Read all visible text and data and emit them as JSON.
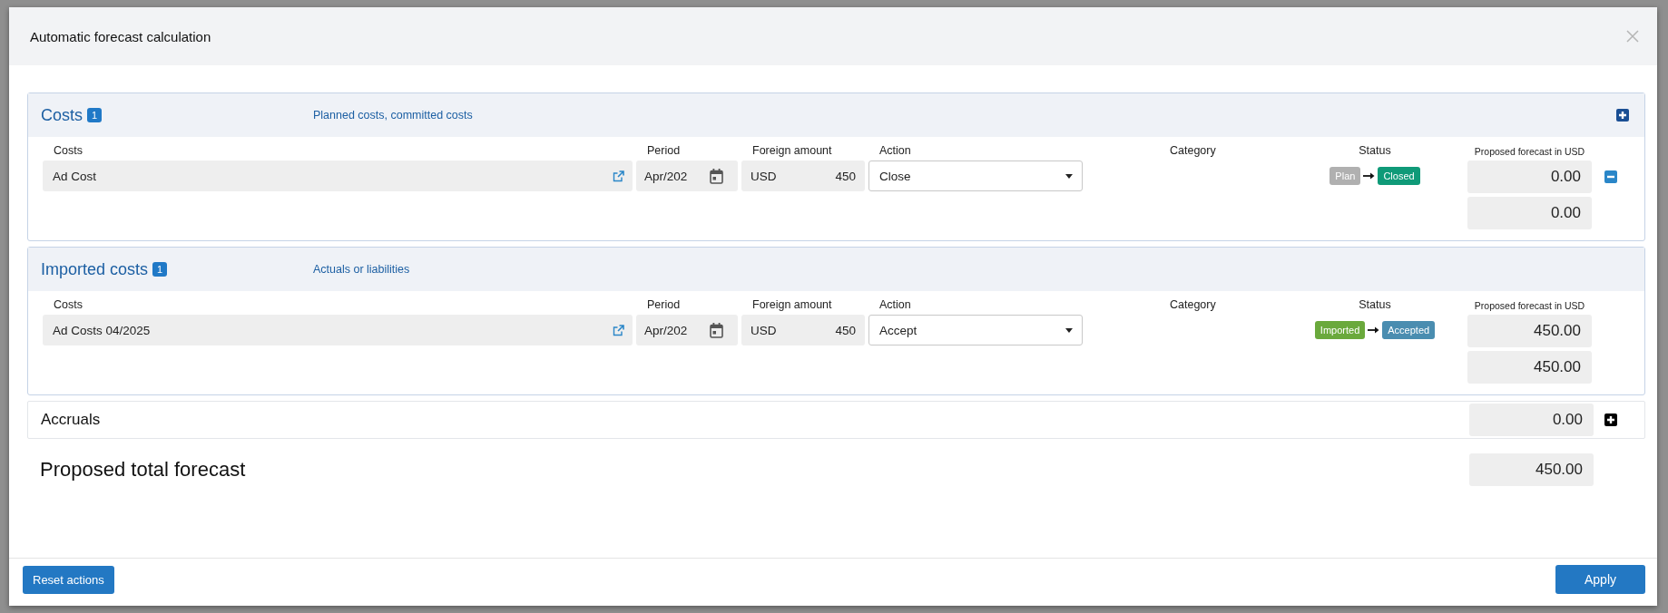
{
  "dialog": {
    "title": "Automatic forecast calculation"
  },
  "sections": [
    {
      "kind": "planned",
      "title": "Costs",
      "count": "1",
      "subtitle": "Planned costs, committed costs",
      "columns": [
        "Costs",
        "Period",
        "Foreign amount",
        "Action",
        "Category",
        "Status",
        "Proposed forecast in USD"
      ],
      "rows": [
        {
          "cost": "Ad Cost",
          "period": "Apr/202",
          "currency": "USD",
          "amount": "450",
          "action": "Close",
          "status_from": {
            "label": "Plan",
            "color": "#b0b0b0"
          },
          "status_to": {
            "label": "Closed",
            "color": "#0f9a78"
          },
          "forecast": [
            "0.00",
            "0.00"
          ]
        }
      ]
    },
    {
      "kind": "imported",
      "title": "Imported costs",
      "count": "1",
      "subtitle": "Actuals or liabilities",
      "columns": [
        "Costs",
        "Period",
        "Foreign amount",
        "Action",
        "Category",
        "Status",
        "Proposed forecast in USD"
      ],
      "rows": [
        {
          "cost": "Ad Costs 04/2025",
          "period": "Apr/202",
          "currency": "USD",
          "amount": "450",
          "action": "Accept",
          "status_from": {
            "label": "Imported",
            "color": "#6aa93c"
          },
          "status_to": {
            "label": "Accepted",
            "color": "#4a8db0"
          },
          "forecast": [
            "450.00",
            "450.00"
          ]
        }
      ]
    }
  ],
  "accruals": {
    "title": "Accruals",
    "forecast": "0.00"
  },
  "total": {
    "label": "Proposed total forecast",
    "value": "450.00"
  },
  "footer": {
    "reset": "Reset actions",
    "apply": "Apply"
  }
}
